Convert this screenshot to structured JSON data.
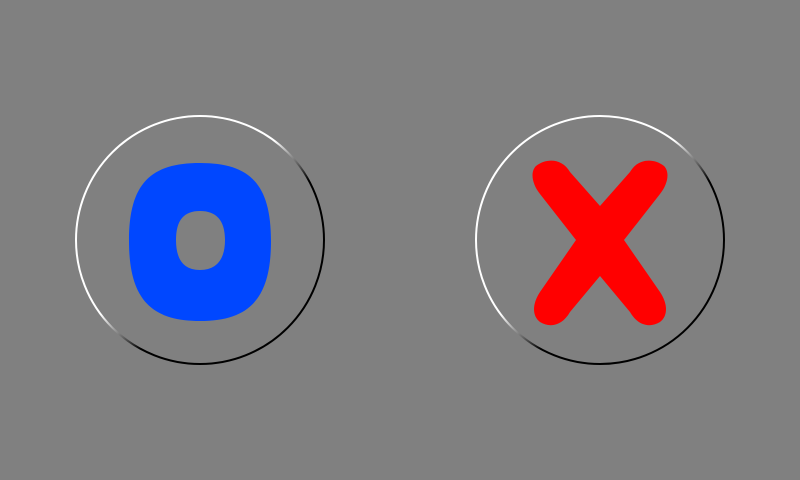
{
  "game": {
    "title": "",
    "choices": [
      {
        "id": "o",
        "icon": "o-symbol-icon",
        "color": "#0047FF"
      },
      {
        "id": "x",
        "icon": "x-symbol-icon",
        "color": "#FF0000"
      }
    ]
  },
  "colors": {
    "background": "#808080",
    "ring_light": "#FFFFFF",
    "ring_dark": "#000000"
  }
}
